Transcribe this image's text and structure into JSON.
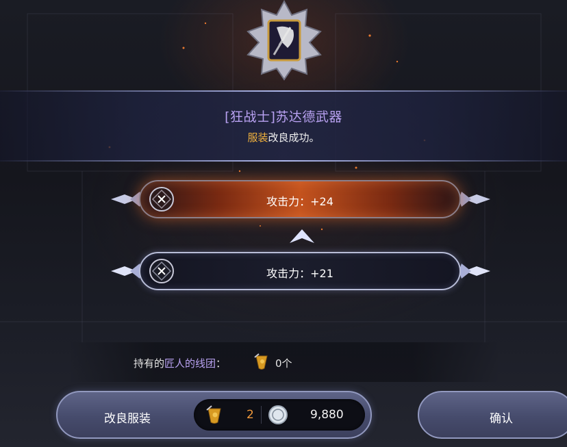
{
  "item": {
    "title": "[狂战士]苏达德武器",
    "subtitle_highlight": "服装",
    "subtitle_rest": "改良成功。",
    "emblem_icon": "axe-icon"
  },
  "stats": {
    "new_label": "攻击力：+24",
    "old_label": "攻击力：+21",
    "arrow_icon": "up-arrow-icon"
  },
  "materials": {
    "prefix": "持有的",
    "name": "匠人的线团",
    "suffix": "：",
    "icon": "thread-spool-icon",
    "count": "0个"
  },
  "actions": {
    "improve_label": "改良服装",
    "cost_material_count": "2",
    "cost_gold": "9,880",
    "coin_icon": "silver-coin-icon",
    "confirm_label": "确认"
  },
  "colors": {
    "title": "#b9a2f2",
    "highlight": "#f3b33d",
    "material_cost": "#f19a3c",
    "new_bar": "#c4531e"
  }
}
